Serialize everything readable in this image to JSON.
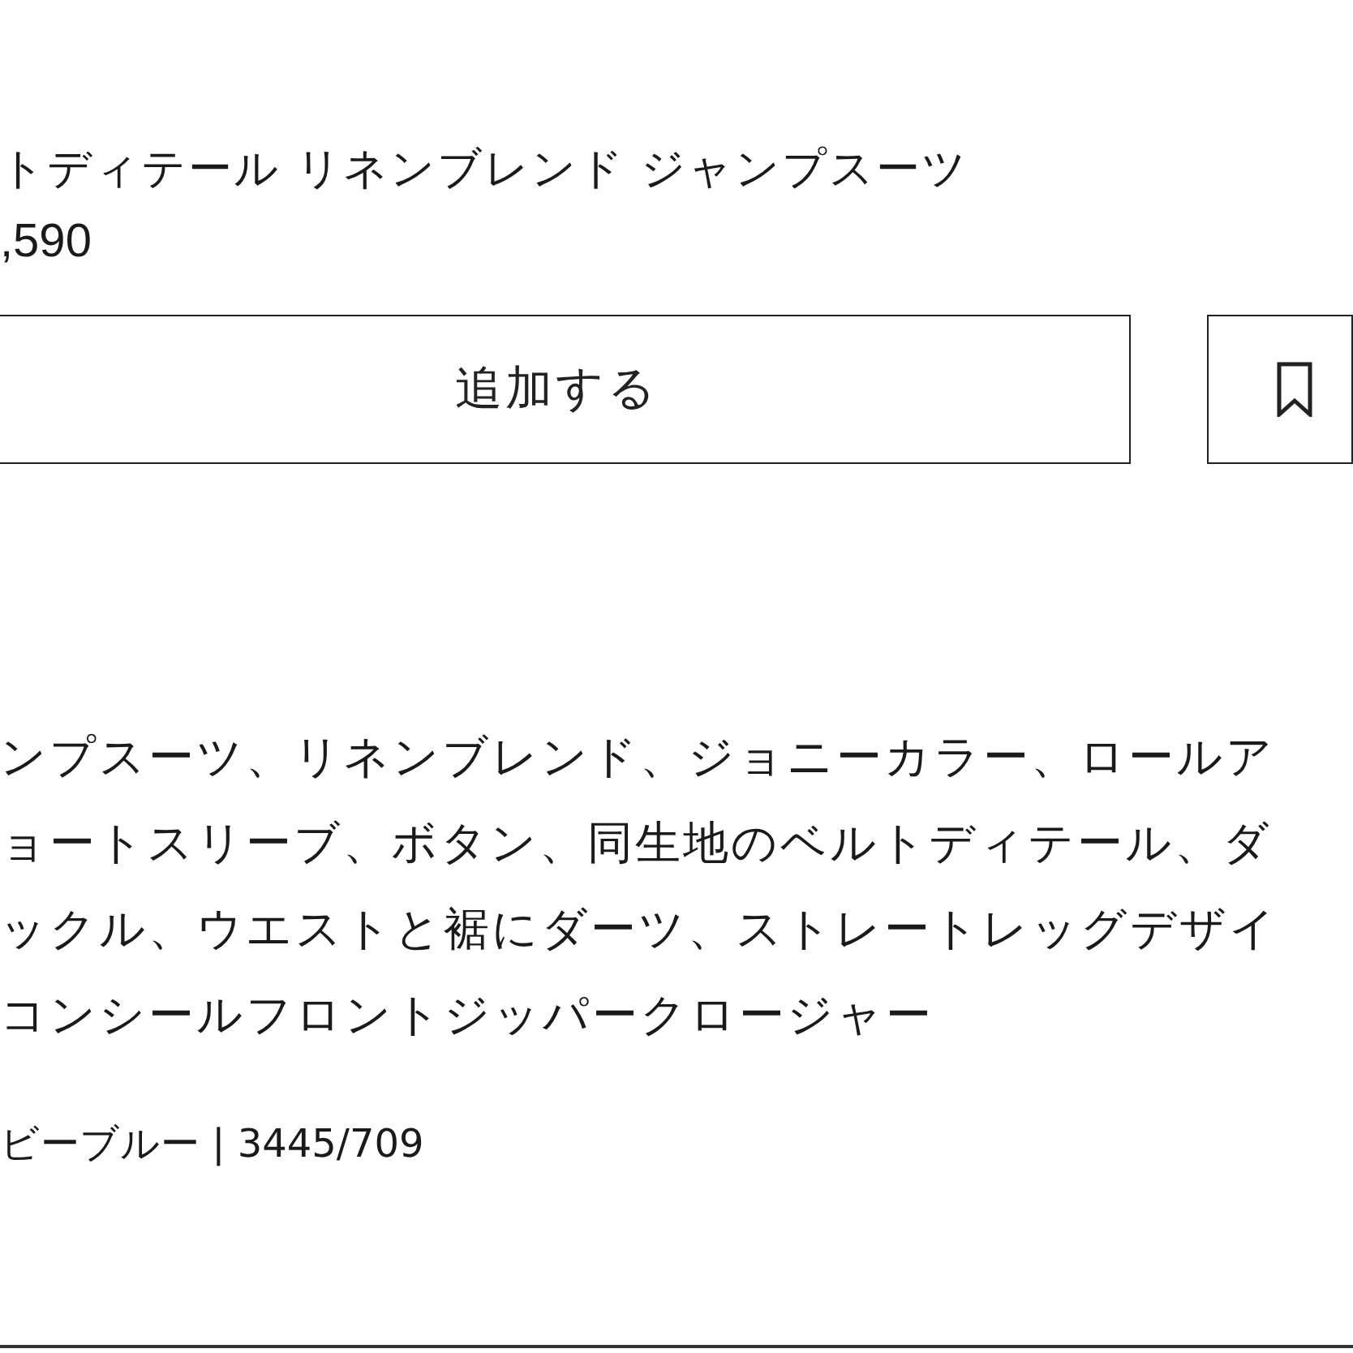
{
  "product": {
    "title": "トディテール リネンブレンド ジャンプスーツ",
    "price": ",590"
  },
  "add_button": {
    "label": "追加する"
  },
  "wishlist_button": {
    "kind": "bookmark"
  },
  "description_lines": [
    "ンプスーツ、リネンブレンド、ジョニーカラー、ロールア",
    "ョートスリーブ、ボタン、同生地のベルトディテール、ダ",
    "ックル、ウエストと裾にダーツ、ストレートレッグデザイ",
    "コンシールフロントジッパークロージャー"
  ],
  "color_reference": "ビーブルー | 3445/709"
}
